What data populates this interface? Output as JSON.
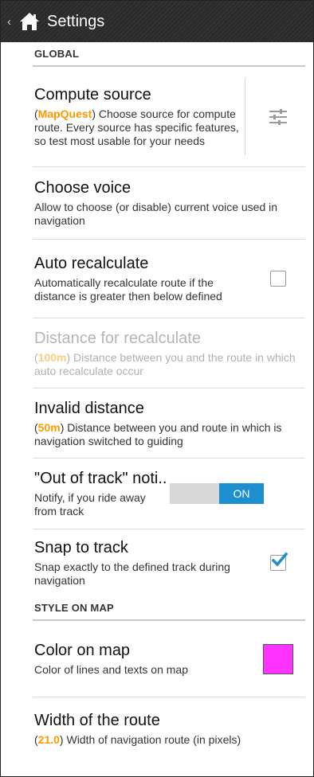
{
  "actionbar": {
    "back_glyph": "‹",
    "title": "Settings",
    "icon": "home-icon"
  },
  "sections": {
    "global": "GLOBAL",
    "style": "STYLE ON MAP"
  },
  "prefs": {
    "compute_source": {
      "title": "Compute source",
      "highlight": "MapQuest",
      "summary_pre": "(",
      "summary_post": ") Choose source for compute route. Every source has specific features, so test most usable for your needs",
      "icon": "sliders-icon"
    },
    "choose_voice": {
      "title": "Choose voice",
      "summary": "Allow to choose (or disable) current voice used in navigation"
    },
    "auto_recalculate": {
      "title": "Auto recalculate",
      "summary": "Automatically recalculate route if the distance is greater then below defined",
      "checked": false
    },
    "distance_recalculate": {
      "title": "Distance for recalculate",
      "highlight": "100m",
      "summary_pre": "(",
      "summary_post": ") Distance between you and the route in which auto recalculate occur"
    },
    "invalid_distance": {
      "title": "Invalid distance",
      "highlight": "50m",
      "summary_pre": "(",
      "summary_post": ") Distance between you and route in which is navigation switched to guiding"
    },
    "out_of_track": {
      "title": "\"Out of track\" noti..",
      "summary": "Notify, if you ride away from track",
      "toggle_label": "ON"
    },
    "snap_to_track": {
      "title": "Snap to track",
      "summary": "Snap exactly to the defined track during navigation",
      "checked": true
    },
    "color_on_map": {
      "title": "Color on map",
      "summary": "Color of lines and texts on map",
      "color": "#ff33ff"
    },
    "width_route": {
      "title": "Width of the route",
      "highlight": "21.0",
      "summary_pre": "(",
      "summary_post": ") Width of navigation route (in pixels)"
    }
  },
  "colors": {
    "accent": "#ff9900",
    "toggle_on": "#1d8fd1",
    "actionbar": "#2b2b2b"
  }
}
